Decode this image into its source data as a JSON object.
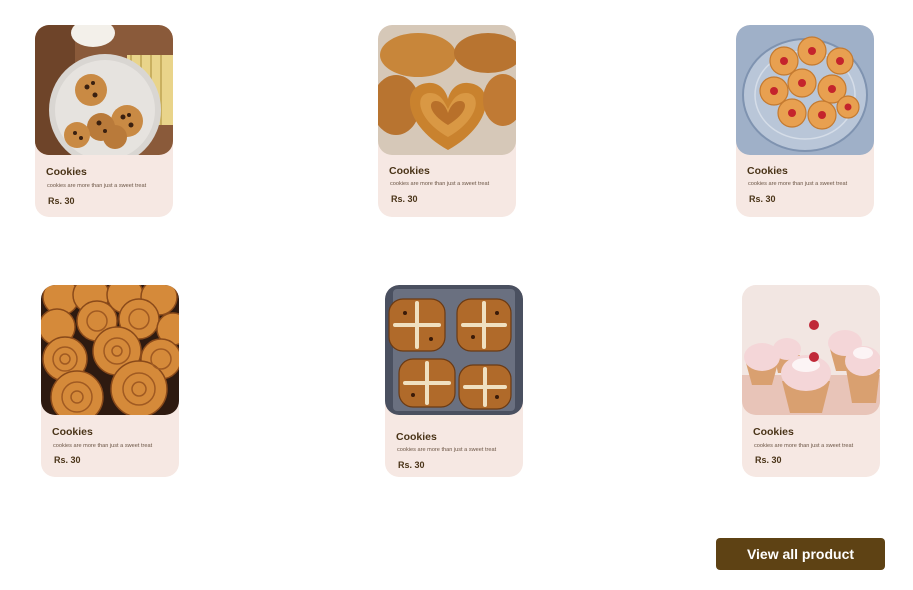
{
  "products": [
    {
      "image": "chocolate-chip-cookies-image",
      "title": "Cookies",
      "description": "cookies are more than just a sweet treat",
      "price": "Rs. 30"
    },
    {
      "image": "heart-shaped-pastries-image",
      "title": "Cookies",
      "description": "cookies are more than just a sweet treat",
      "price": "Rs. 30"
    },
    {
      "image": "jam-flower-cookies-image",
      "title": "Cookies",
      "description": "cookies are more than just a sweet treat",
      "price": "Rs. 30"
    },
    {
      "image": "cinnamon-rolls-image",
      "title": "Cookies",
      "description": "cookies are more than just a sweet treat",
      "price": "Rs. 30"
    },
    {
      "image": "hot-cross-buns-image",
      "title": "Cookies",
      "description": "cookies are more than just a sweet treat",
      "price": "Rs. 30"
    },
    {
      "image": "cupcakes-image",
      "title": "Cookies",
      "description": "cookies are more than just a sweet treat",
      "price": "Rs. 30"
    }
  ],
  "actions": {
    "view_all_label": "View all product"
  },
  "colors": {
    "card_background": "#f6e8e3",
    "text_dark": "#4a3418",
    "button_background": "#5e4214",
    "button_text": "#ffffff"
  }
}
